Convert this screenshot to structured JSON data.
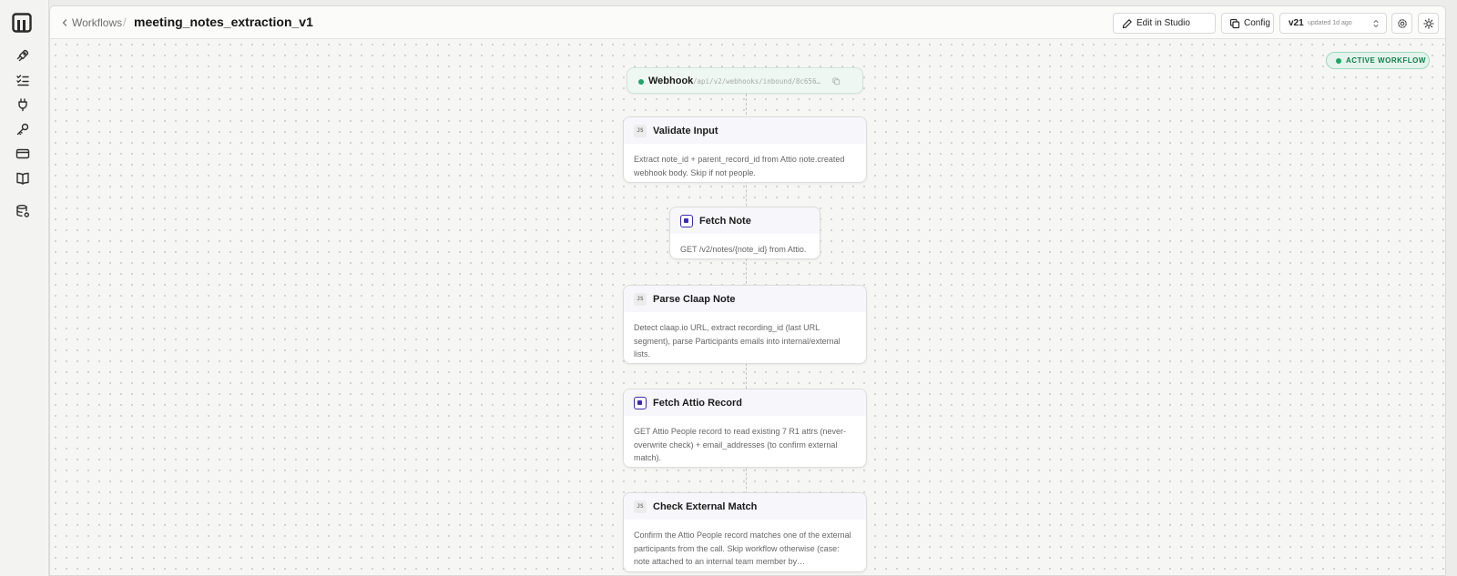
{
  "breadcrumb": {
    "parent": "Workflows",
    "separator": "/"
  },
  "page": {
    "title": "meeting_notes_extraction_v1"
  },
  "toolbar": {
    "edit_label": "Edit in Studio",
    "config_label": "Config",
    "version": "v21",
    "version_updated": "updated 1d ago"
  },
  "status": {
    "label": "ACTIVE WORKFLOW",
    "color": "#1fa567"
  },
  "webhook": {
    "label": "Webhook",
    "path": "/api/v2/webhooks/inbound/8c656…"
  },
  "nodes": [
    {
      "type": "js",
      "icon_text": "JS",
      "title": "Validate Input",
      "description": "Extract note_id + parent_record_id from Attio note.created webhook body. Skip if not people."
    },
    {
      "type": "attio",
      "icon_text": "",
      "title": "Fetch Note",
      "description": "GET /v2/notes/{note_id} from Attio."
    },
    {
      "type": "js",
      "icon_text": "JS",
      "title": "Parse Claap Note",
      "description": "Detect claap.io URL, extract recording_id (last URL segment), parse Participants emails into internal/external lists."
    },
    {
      "type": "attio",
      "icon_text": "",
      "title": "Fetch Attio Record",
      "description": "GET Attio People record to read existing 7 R1 attrs (never-overwrite check) + email_addresses (to confirm external match)."
    },
    {
      "type": "js",
      "icon_text": "JS",
      "title": "Check External Match",
      "description": "Confirm the Attio People record matches one of the external participants from the call. Skip workflow otherwise (case: note attached to an internal team member by…"
    }
  ],
  "icons": {
    "logo": "brand-logo",
    "rail": [
      "rocket-icon",
      "checklist-icon",
      "plug-icon",
      "key-icon",
      "card-icon",
      "book-icon",
      "database-icon"
    ]
  },
  "colors": {
    "attio": "#3b2bb0",
    "accent_green": "#1fa567"
  }
}
